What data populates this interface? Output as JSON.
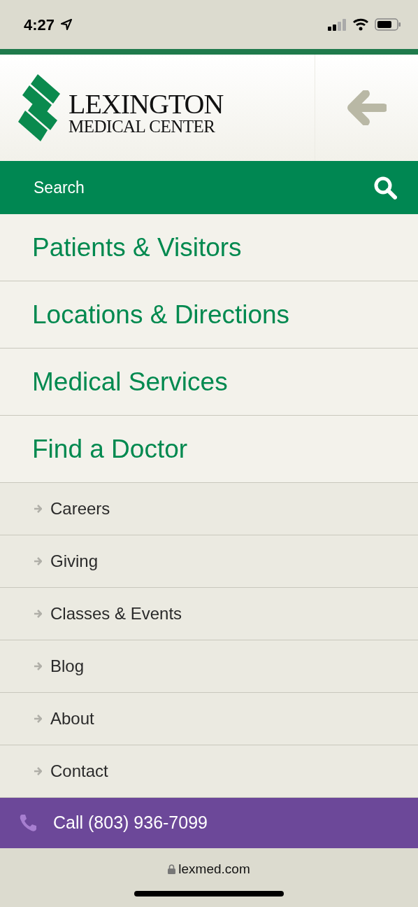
{
  "status_bar": {
    "time": "4:27"
  },
  "logo": {
    "line1": "LEXINGTON",
    "line2": "MEDICAL CENTER"
  },
  "search": {
    "placeholder": "Search"
  },
  "primary_menu": [
    "Patients & Visitors",
    "Locations & Directions",
    "Medical Services",
    "Find a Doctor"
  ],
  "secondary_menu": [
    "Careers",
    "Giving",
    "Classes & Events",
    "Blog",
    "About",
    "Contact"
  ],
  "call_bar": {
    "label": "Call (803) 936-7099"
  },
  "address_bar": {
    "url": "lexmed.com"
  }
}
